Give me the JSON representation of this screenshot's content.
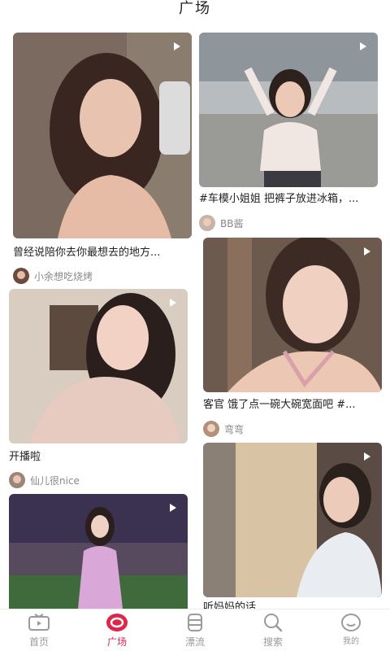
{
  "header": {
    "title": "广场"
  },
  "feed": [
    {
      "title": "曾经说陪你去你最想去的地方...",
      "author": "小余想吃烧烤"
    },
    {
      "title": "#车模小姐姐 把裤子放进冰箱，...",
      "author": "BB酱"
    },
    {
      "title": "开播啦",
      "author": "仙儿很nice"
    },
    {
      "title": "客官 饿了点一碗大碗宽面吧 #...",
      "author": "弯弯"
    },
    {
      "title": "",
      "author": ""
    },
    {
      "title": "听妈妈的话",
      "author": ""
    }
  ],
  "tabbar": {
    "items": [
      {
        "label": "首页",
        "icon": "tv-icon"
      },
      {
        "label": "广场",
        "icon": "square-icon"
      },
      {
        "label": "漂流",
        "icon": "bottle-icon"
      },
      {
        "label": "搜索",
        "icon": "search-icon"
      },
      {
        "label": "我的",
        "icon": "profile-icon"
      }
    ],
    "active_color": "#e0254b",
    "inactive_color": "#999999"
  }
}
